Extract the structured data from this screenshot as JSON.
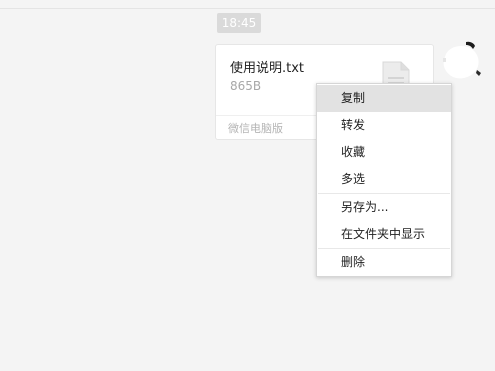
{
  "chat": {
    "timestamp": "18:45",
    "file_message": {
      "file_name": "使用说明.txt",
      "file_size": "865B",
      "source": "微信电脑版",
      "icon": "text-file-icon"
    },
    "avatar": {
      "icon": "user-avatar-icon"
    }
  },
  "context_menu": {
    "highlighted_index": 0,
    "groups": [
      [
        {
          "label": "复制"
        },
        {
          "label": "转发"
        },
        {
          "label": "收藏"
        },
        {
          "label": "多选"
        }
      ],
      [
        {
          "label": "另存为..."
        },
        {
          "label": "在文件夹中显示"
        }
      ],
      [
        {
          "label": "删除"
        }
      ]
    ]
  },
  "colors": {
    "background": "#f4f4f4",
    "card": "#ffffff",
    "menu_highlight": "#e2e2e2",
    "timestamp_bg": "#dadada"
  }
}
